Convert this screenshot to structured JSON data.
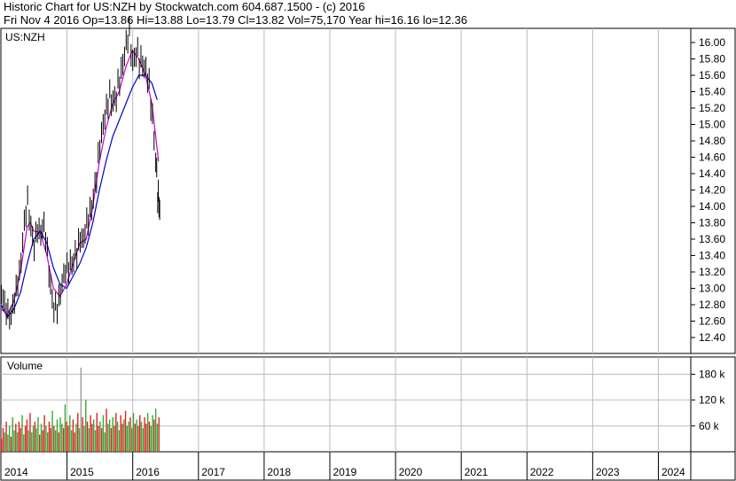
{
  "header": {
    "title": "Historic Chart for US:NZH by Stockwatch.com 604.687.1500 - (c) 2016",
    "quote": "Fri Nov  4 2016   Op=13.86   Hi=13.88   Lo=13.79   Cl=13.82   Vol=75,170   Year hi=16.16   lo=12.36"
  },
  "chart_data": {
    "type": "line",
    "symbol_label": "US:NZH",
    "volume_label": "Volume",
    "price_axis": {
      "min": 12.2,
      "max": 16.2,
      "ticks": [
        "16.00",
        "15.80",
        "15.60",
        "15.40",
        "15.20",
        "15.00",
        "14.80",
        "14.60",
        "14.40",
        "14.20",
        "14.00",
        "13.80",
        "13.60",
        "13.40",
        "13.20",
        "13.00",
        "12.80",
        "12.60",
        "12.40"
      ]
    },
    "volume_axis": {
      "max": 220000,
      "ticks": [
        {
          "label": "180 k",
          "value": 180000
        },
        {
          "label": "120 k",
          "value": 120000
        },
        {
          "label": "60 k",
          "value": 60000
        }
      ]
    },
    "x_axis": {
      "start_year": 2014,
      "end_year": 2024.5,
      "years": [
        "2014",
        "2015",
        "2016",
        "2017",
        "2018",
        "2019",
        "2020",
        "2021",
        "2022",
        "2023",
        "2024"
      ]
    },
    "grid": true,
    "colors": {
      "price": "#000000",
      "ma_short": "#cc00cc",
      "ma_long": "#0000cc",
      "vol_up": "#33aa33",
      "vol_down": "#dd2222",
      "vol_spike": "#999999",
      "grid": "#bbbbbb"
    },
    "series": [
      {
        "role": "price",
        "points": [
          [
            2014.0,
            12.9
          ],
          [
            2014.05,
            12.7
          ],
          [
            2014.1,
            12.65
          ],
          [
            2014.15,
            12.75
          ],
          [
            2014.2,
            12.95
          ],
          [
            2014.25,
            13.1
          ],
          [
            2014.3,
            13.3
          ],
          [
            2014.35,
            13.7
          ],
          [
            2014.4,
            14.0
          ],
          [
            2014.45,
            13.8
          ],
          [
            2014.5,
            13.6
          ],
          [
            2014.55,
            13.75
          ],
          [
            2014.6,
            13.65
          ],
          [
            2014.65,
            13.7
          ],
          [
            2014.7,
            13.35
          ],
          [
            2014.75,
            13.05
          ],
          [
            2014.8,
            12.85
          ],
          [
            2014.85,
            12.8
          ],
          [
            2014.9,
            12.95
          ],
          [
            2014.95,
            13.1
          ],
          [
            2015.0,
            13.15
          ],
          [
            2015.05,
            13.3
          ],
          [
            2015.1,
            13.45
          ],
          [
            2015.15,
            13.5
          ],
          [
            2015.2,
            13.6
          ],
          [
            2015.25,
            13.55
          ],
          [
            2015.3,
            13.7
          ],
          [
            2015.35,
            13.9
          ],
          [
            2015.4,
            14.2
          ],
          [
            2015.45,
            14.45
          ],
          [
            2015.5,
            14.75
          ],
          [
            2015.55,
            14.95
          ],
          [
            2015.6,
            15.1
          ],
          [
            2015.65,
            15.3
          ],
          [
            2015.7,
            15.35
          ],
          [
            2015.75,
            15.45
          ],
          [
            2015.8,
            15.55
          ],
          [
            2015.85,
            15.7
          ],
          [
            2015.9,
            15.9
          ],
          [
            2015.95,
            16.05
          ],
          [
            2016.0,
            15.8
          ],
          [
            2016.05,
            16.0
          ],
          [
            2016.1,
            15.8
          ],
          [
            2016.15,
            15.7
          ],
          [
            2016.2,
            15.6
          ],
          [
            2016.25,
            15.4
          ],
          [
            2016.3,
            15.1
          ],
          [
            2016.35,
            14.7
          ],
          [
            2016.38,
            14.2
          ],
          [
            2016.4,
            14.0
          ],
          [
            2016.42,
            13.82
          ]
        ]
      },
      {
        "role": "ma_short",
        "points": [
          [
            2014.0,
            12.75
          ],
          [
            2014.1,
            12.68
          ],
          [
            2014.2,
            12.85
          ],
          [
            2014.3,
            13.2
          ],
          [
            2014.4,
            13.75
          ],
          [
            2014.45,
            13.8
          ],
          [
            2014.5,
            13.7
          ],
          [
            2014.6,
            13.68
          ],
          [
            2014.7,
            13.4
          ],
          [
            2014.8,
            13.0
          ],
          [
            2014.9,
            12.9
          ],
          [
            2015.0,
            13.05
          ],
          [
            2015.1,
            13.3
          ],
          [
            2015.2,
            13.55
          ],
          [
            2015.3,
            13.6
          ],
          [
            2015.4,
            14.0
          ],
          [
            2015.5,
            14.55
          ],
          [
            2015.6,
            14.95
          ],
          [
            2015.7,
            15.25
          ],
          [
            2015.8,
            15.4
          ],
          [
            2015.9,
            15.7
          ],
          [
            2016.0,
            15.9
          ],
          [
            2016.1,
            15.8
          ],
          [
            2016.2,
            15.6
          ],
          [
            2016.3,
            15.25
          ],
          [
            2016.35,
            14.9
          ],
          [
            2016.4,
            14.55
          ]
        ]
      },
      {
        "role": "ma_long",
        "points": [
          [
            2014.0,
            12.8
          ],
          [
            2014.1,
            12.65
          ],
          [
            2014.2,
            12.75
          ],
          [
            2014.3,
            12.95
          ],
          [
            2014.4,
            13.3
          ],
          [
            2014.5,
            13.6
          ],
          [
            2014.6,
            13.7
          ],
          [
            2014.7,
            13.55
          ],
          [
            2014.8,
            13.25
          ],
          [
            2014.9,
            13.05
          ],
          [
            2015.0,
            13.0
          ],
          [
            2015.1,
            13.15
          ],
          [
            2015.2,
            13.3
          ],
          [
            2015.3,
            13.5
          ],
          [
            2015.4,
            13.8
          ],
          [
            2015.5,
            14.2
          ],
          [
            2015.6,
            14.55
          ],
          [
            2015.7,
            14.85
          ],
          [
            2015.8,
            15.05
          ],
          [
            2015.9,
            15.25
          ],
          [
            2016.0,
            15.45
          ],
          [
            2016.1,
            15.6
          ],
          [
            2016.2,
            15.6
          ],
          [
            2016.3,
            15.5
          ],
          [
            2016.38,
            15.3
          ]
        ]
      }
    ],
    "volume": [
      30,
      55,
      45,
      70,
      40,
      60,
      35,
      80,
      50,
      65,
      45,
      70,
      55,
      85,
      40,
      60,
      75,
      50,
      90,
      45,
      60,
      70,
      55,
      80,
      40,
      65,
      50,
      85,
      60,
      45,
      70,
      55,
      95,
      60,
      50,
      75,
      45,
      80,
      65,
      55,
      110,
      70,
      60,
      85,
      50,
      75,
      45,
      65,
      90,
      55,
      195,
      80,
      60,
      120,
      70,
      55,
      85,
      65,
      75,
      50,
      90,
      60,
      70,
      55,
      85,
      45,
      100,
      65,
      75,
      55,
      80,
      60,
      90,
      70,
      50,
      85,
      65,
      75,
      95,
      60,
      70,
      80,
      55,
      90,
      65,
      75,
      60,
      85,
      70,
      55,
      80,
      65,
      90,
      70,
      60,
      85,
      75,
      100,
      65,
      80
    ],
    "volume_unit": "thousand shares"
  }
}
